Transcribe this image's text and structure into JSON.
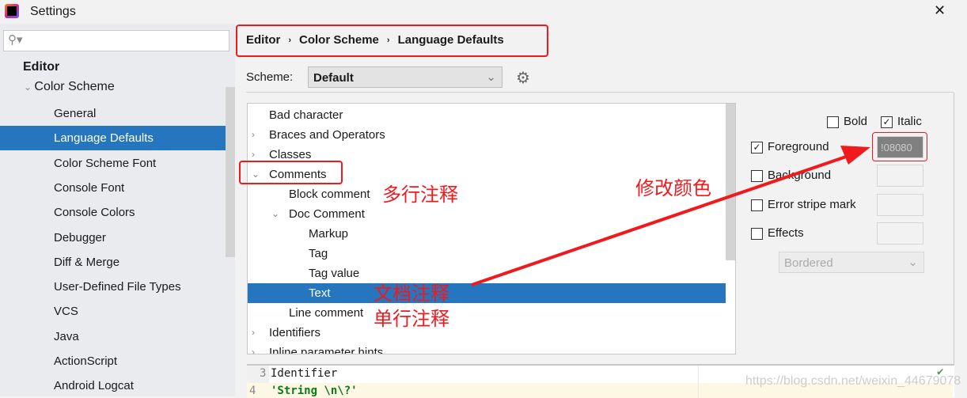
{
  "window": {
    "title": "Settings",
    "close": "✕"
  },
  "search": {
    "placeholder": ""
  },
  "sidebar": {
    "section": "Editor",
    "group": "Color Scheme",
    "items": [
      "General",
      "Language Defaults",
      "Color Scheme Font",
      "Console Font",
      "Console Colors",
      "Debugger",
      "Diff & Merge",
      "User-Defined File Types",
      "VCS",
      "Java",
      "ActionScript",
      "Android Logcat"
    ],
    "selected": "Language Defaults"
  },
  "breadcrumb": [
    "Editor",
    "Color Scheme",
    "Language Defaults"
  ],
  "scheme": {
    "label": "Scheme:",
    "value": "Default"
  },
  "tree": [
    {
      "label": "Bad character",
      "level": 0,
      "arrow": ""
    },
    {
      "label": "Braces and Operators",
      "level": 0,
      "arrow": "›"
    },
    {
      "label": "Classes",
      "level": 0,
      "arrow": "›"
    },
    {
      "label": "Comments",
      "level": 0,
      "arrow": "⌄"
    },
    {
      "label": "Block comment",
      "level": 1,
      "arrow": ""
    },
    {
      "label": "Doc Comment",
      "level": 1,
      "arrow": "⌄"
    },
    {
      "label": "Markup",
      "level": 2,
      "arrow": ""
    },
    {
      "label": "Tag",
      "level": 2,
      "arrow": ""
    },
    {
      "label": "Tag value",
      "level": 2,
      "arrow": ""
    },
    {
      "label": "Text",
      "level": 2,
      "arrow": "",
      "selected": true
    },
    {
      "label": "Line comment",
      "level": 1,
      "arrow": ""
    },
    {
      "label": "Identifiers",
      "level": 0,
      "arrow": "›"
    },
    {
      "label": "Inline parameter hints",
      "level": 0,
      "arrow": "›"
    }
  ],
  "options": {
    "bold": {
      "label": "Bold",
      "checked": false
    },
    "italic": {
      "label": "Italic",
      "checked": true
    },
    "foreground": {
      "label": "Foreground",
      "checked": true,
      "value": "808080"
    },
    "foreground_text": "!08080",
    "background": {
      "label": "Background",
      "checked": false
    },
    "error_stripe": {
      "label": "Error stripe mark",
      "checked": false
    },
    "effects": {
      "label": "Effects",
      "checked": false
    },
    "effect_type": "Bordered"
  },
  "annotations": {
    "block": "多行注释",
    "doc": "文档注释",
    "line": "单行注释",
    "change": "修改颜色"
  },
  "preview": {
    "lines": [
      {
        "num": "3",
        "text": "Identifier"
      },
      {
        "num": "4",
        "text": "'String \\n\\?'"
      }
    ]
  },
  "watermark": "https://blog.csdn.net/weixin_44679078",
  "colors": {
    "accent": "#2675bf",
    "annotation": "#f0191c"
  }
}
